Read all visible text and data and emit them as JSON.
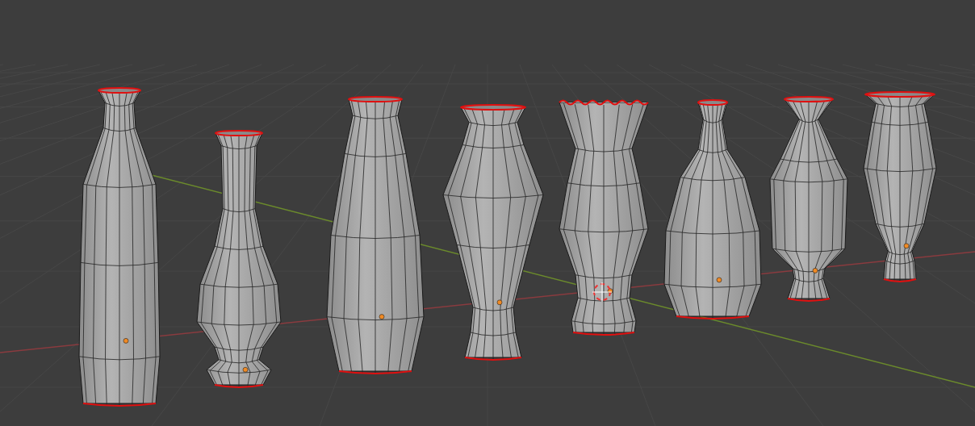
{
  "viewport": {
    "vases": [
      {
        "kind": "plain",
        "selected": true
      },
      {
        "kind": "plain",
        "selected": true
      },
      {
        "kind": "plain",
        "selected": true
      },
      {
        "kind": "plain",
        "selected": true
      },
      {
        "kind": "fluted",
        "selected": true
      },
      {
        "kind": "plain",
        "selected": true
      },
      {
        "kind": "plain",
        "selected": true
      },
      {
        "kind": "plain",
        "selected": true
      }
    ]
  }
}
